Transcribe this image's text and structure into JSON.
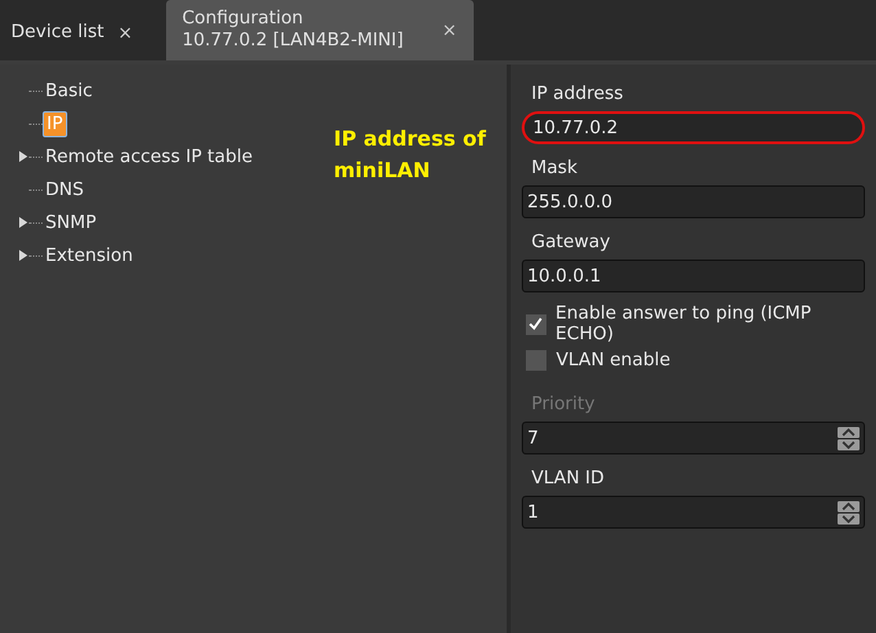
{
  "tabs": [
    {
      "title": "Device list",
      "close": "×",
      "selected": false
    },
    {
      "title": "Configuration",
      "subtitle": "10.77.0.2 [LAN4B2-MINI]",
      "close": "×",
      "selected": true
    }
  ],
  "tree": [
    {
      "label": "Basic",
      "selected": false
    },
    {
      "label": "IP",
      "selected": true
    },
    {
      "label": "Remote access IP table",
      "selected": false,
      "expanded": false
    },
    {
      "label": "DNS",
      "selected": false
    },
    {
      "label": "SNMP",
      "selected": false,
      "expanded": false
    },
    {
      "label": "Extension",
      "selected": false,
      "expanded": false
    }
  ],
  "annotation": {
    "lines": [
      "IP address of",
      "miniLAN"
    ]
  },
  "form": [
    {
      "kind": "field",
      "label": "IP address",
      "value": "10.77.0.2",
      "disabled": false,
      "highlighted": true
    },
    {
      "kind": "field",
      "label": "Mask",
      "value": "255.0.0.0",
      "disabled": false,
      "highlighted": false
    },
    {
      "kind": "field",
      "label": "Gateway",
      "value": "10.0.0.1",
      "disabled": false,
      "highlighted": false
    },
    {
      "kind": "checkbox",
      "label": "Enable answer to ping (ICMP ECHO)",
      "checked": true
    },
    {
      "kind": "checkbox",
      "label": "VLAN enable",
      "checked": false
    },
    {
      "kind": "spin",
      "label": "Priority",
      "value": "7",
      "disabled": true,
      "highlighted": false
    },
    {
      "kind": "spin",
      "label": "VLAN ID",
      "value": "1",
      "disabled": false,
      "highlighted": false
    }
  ]
}
